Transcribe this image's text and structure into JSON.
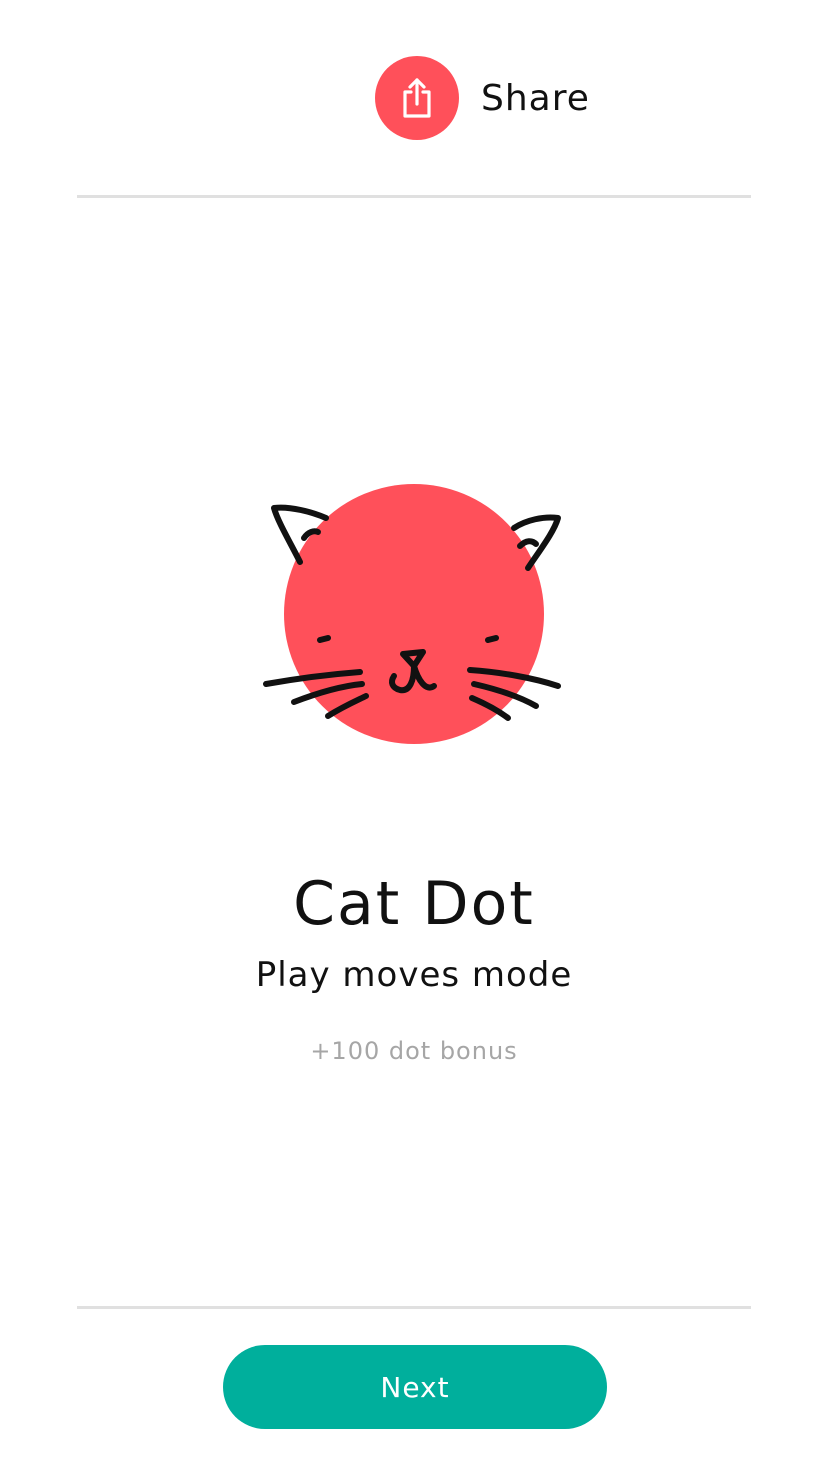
{
  "colors": {
    "accent": "#ff505a",
    "primary_button": "#00af9c",
    "divider": "#e0e0e0",
    "muted_text": "#a6a6a6"
  },
  "share": {
    "label": "Share",
    "icon": "share-icon"
  },
  "dot": {
    "illustration": "cat-face-icon",
    "title": "Cat Dot",
    "subtitle": "Play moves mode",
    "bonus": "+100 dot bonus"
  },
  "footer": {
    "next_label": "Next"
  }
}
